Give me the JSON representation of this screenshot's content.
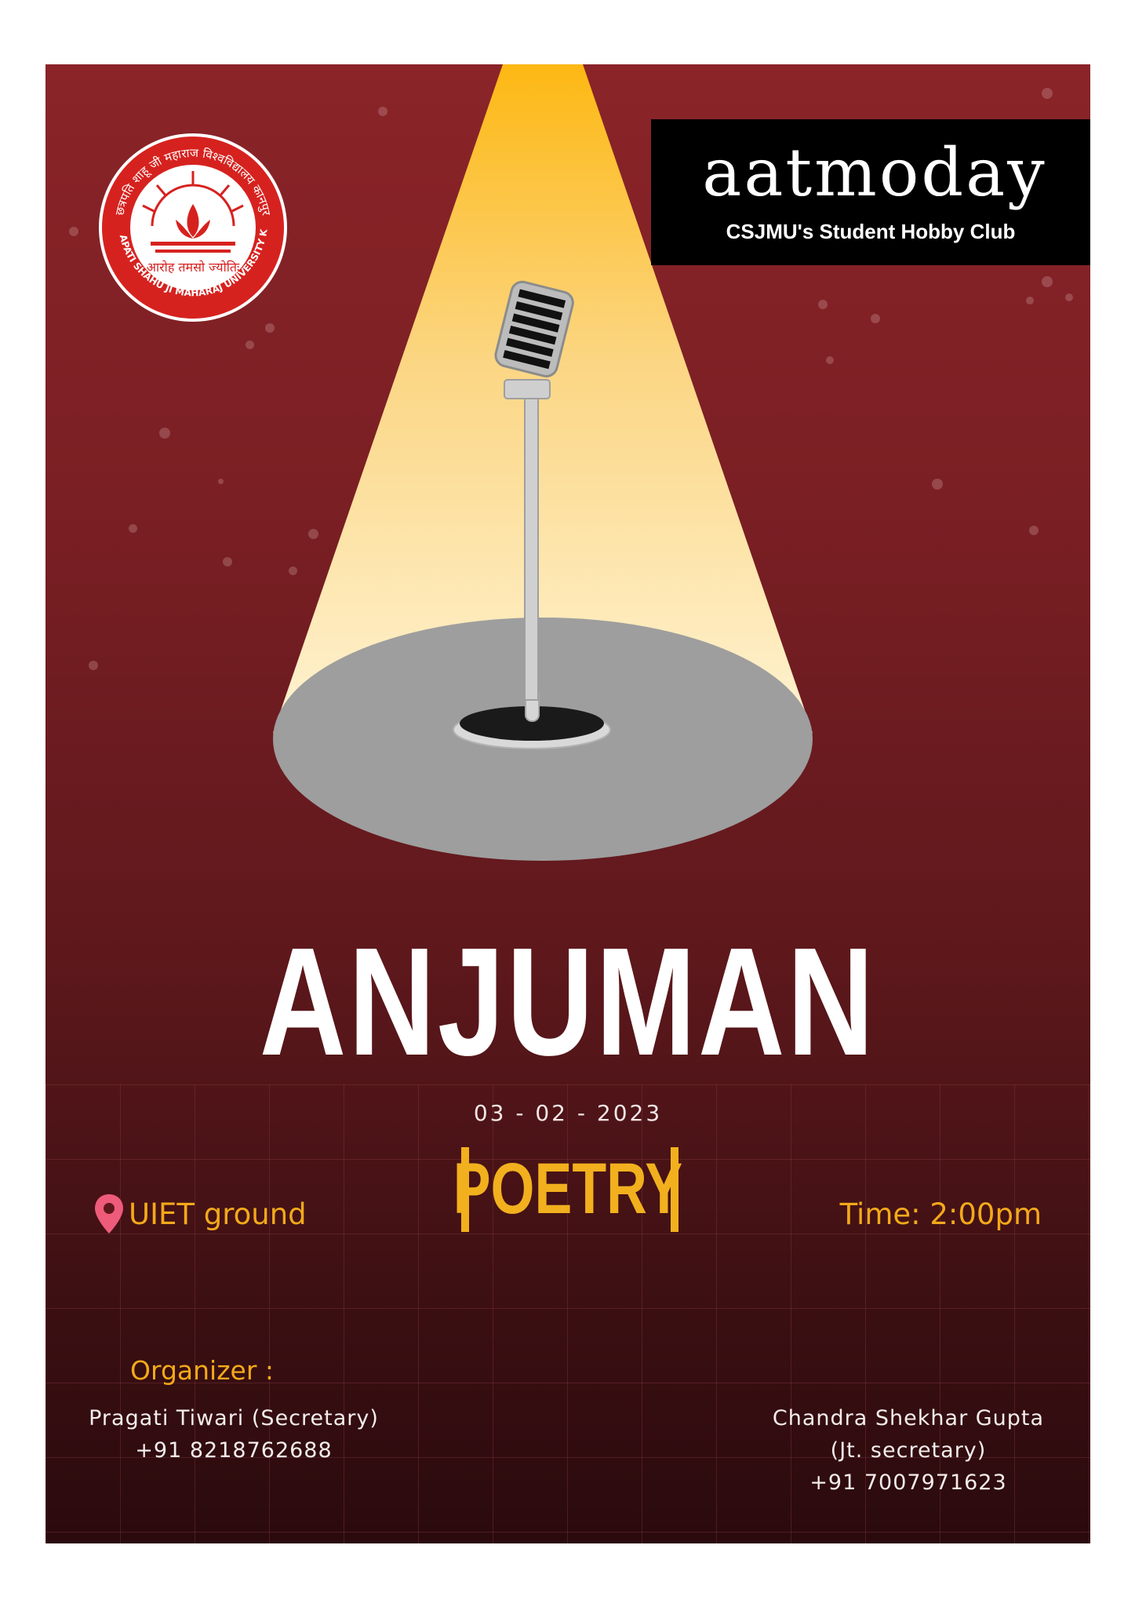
{
  "seal": {
    "hindi_top": "छत्रपति शाहू जी महाराज विश्वविद्यालय कानपुर",
    "motto": "आरोह तमसो ज्योतिः",
    "english_ring": "CHHATRAPATI SHAHU JI MAHARAJ UNIVERSITY KANPUR"
  },
  "brand": {
    "name": "aatmoday",
    "subtitle": "CSJMU's Student Hobby Club"
  },
  "event": {
    "title": "ANJUMAN",
    "date": "03 - 02 - 2023",
    "genre": "POETRY",
    "venue": "UIET ground",
    "time": "Time: 2:00pm"
  },
  "organizer": {
    "label": "Organizer :",
    "person1": {
      "name": "Pragati Tiwari (Secretary)",
      "phone": "+91 8218762688"
    },
    "person2": {
      "name": "Chandra Shekhar Gupta",
      "role": "(Jt. secretary)",
      "phone": "+91 7007971623"
    }
  },
  "icons": {
    "venue": "location-pin-icon",
    "stage": "microphone-icon"
  },
  "colors": {
    "accent": "#f2b01e",
    "background": "#7a1f24",
    "seal": "#d6221f"
  }
}
